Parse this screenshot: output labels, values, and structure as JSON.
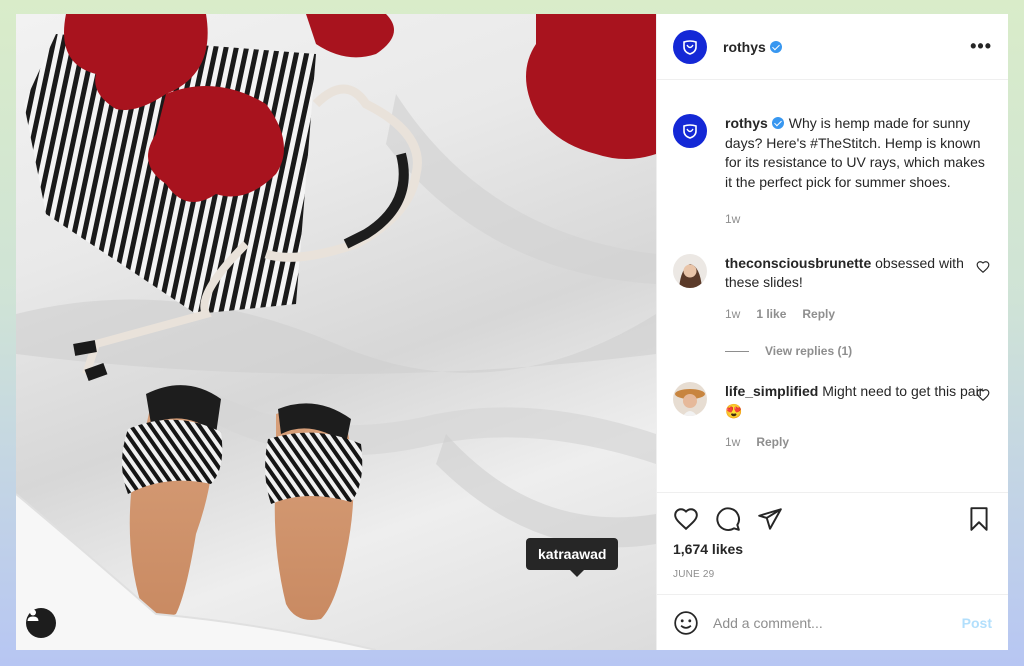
{
  "post": {
    "username": "rothys",
    "tooltip_tag": "katraawad"
  },
  "caption": {
    "username": "rothys",
    "text": "Why is hemp made for sunny days? Here's #TheStitch. Hemp is known for its resistance to UV rays, which makes it the perfect pick for summer shoes.",
    "time": "1w"
  },
  "comments": [
    {
      "username": "theconsciousbrunette",
      "text": "obsessed with these slides!",
      "time": "1w",
      "likes": "1 like",
      "reply": "Reply",
      "view_replies": "View replies (1)"
    },
    {
      "username": "life_simplified",
      "text": "Might need to get this pair 😍",
      "time": "1w",
      "reply": "Reply"
    }
  ],
  "stats": {
    "likes": "1,674 likes",
    "date": "JUNE 29"
  },
  "add_comment": {
    "placeholder": "Add a comment...",
    "post_label": "Post"
  },
  "colors": {
    "brand": "#1428d6",
    "verified": "#3897f0",
    "post_button": "#b2dffc",
    "petals": "#a8131e"
  }
}
